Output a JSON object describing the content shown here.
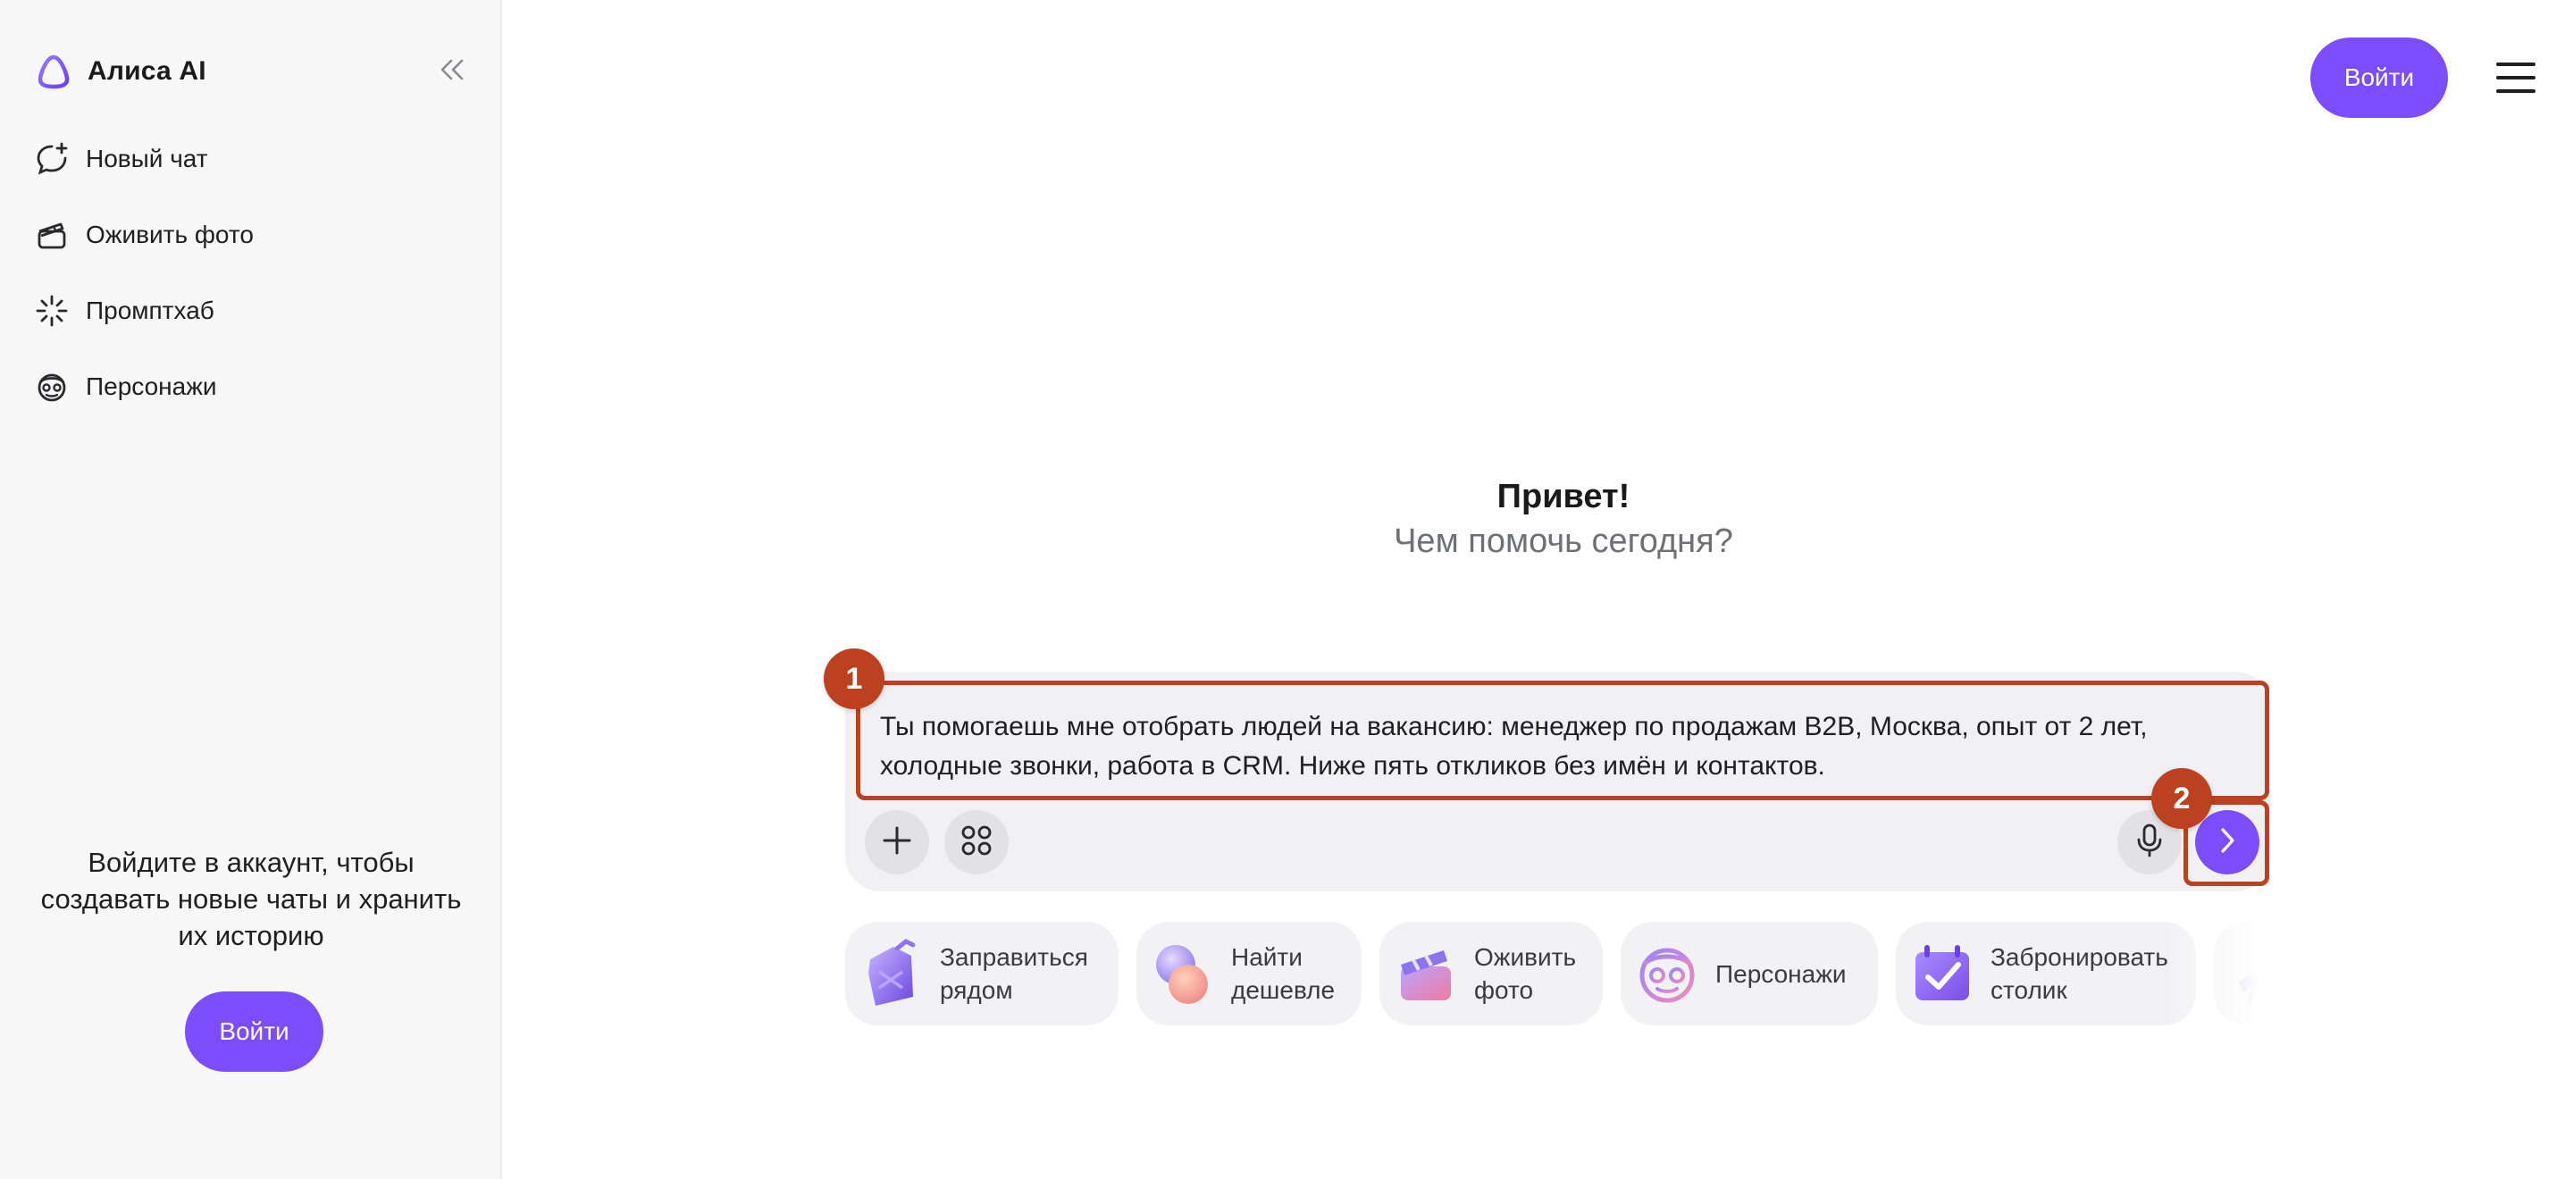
{
  "sidebar": {
    "brand": {
      "name": "Алиса AI",
      "logo_icon": "alice-logo-icon"
    },
    "collapse_icon": "double-chevron-left-icon",
    "nav": [
      {
        "label": "Новый чат",
        "icon": "new-chat-icon"
      },
      {
        "label": "Оживить фото",
        "icon": "clapperboard-icon"
      },
      {
        "label": "Промптхаб",
        "icon": "sparkle-burst-icon"
      },
      {
        "label": "Персонажи",
        "icon": "character-mask-icon"
      }
    ],
    "login_promo": {
      "text": "Войдите в аккаунт, чтобы создавать новые чаты и хранить их историю",
      "button": "Войти"
    }
  },
  "header": {
    "login_button": "Войти",
    "menu_icon": "hamburger-menu-icon"
  },
  "greeting": {
    "title": "Привет!",
    "subtitle": "Чем помочь сегодня?"
  },
  "composer": {
    "value": "Ты помогаешь мне отобрать людей на вакансию: менеджер по продажам B2B, Москва, опыт от 2 лет, холодные звонки, работа в CRM. Ниже пять откликов без имён и контактов.",
    "add_icon": "plus-icon",
    "apps_icon": "grid-circles-icon",
    "mic_icon": "microphone-icon",
    "send_icon": "chevron-right-icon"
  },
  "annotations": [
    "1",
    "2"
  ],
  "suggestions": [
    {
      "label": "Заправиться\nрядом",
      "icon": "fuel-can-icon"
    },
    {
      "label": "Найти\nдешевле",
      "icon": "coins-icon"
    },
    {
      "label": "Оживить\nфото",
      "icon": "clapperboard-icon"
    },
    {
      "label": "Персонажи",
      "icon": "character-mask-icon"
    },
    {
      "label": "Забронировать\nстолик",
      "icon": "calendar-check-icon"
    },
    {
      "label": "",
      "icon": "telescope-icon"
    }
  ],
  "colors": {
    "accent": "#7b4dff",
    "annotation": "#bb4121",
    "sidebar_bg": "#f7f7f8",
    "composer_bg": "#f1f1f3"
  }
}
